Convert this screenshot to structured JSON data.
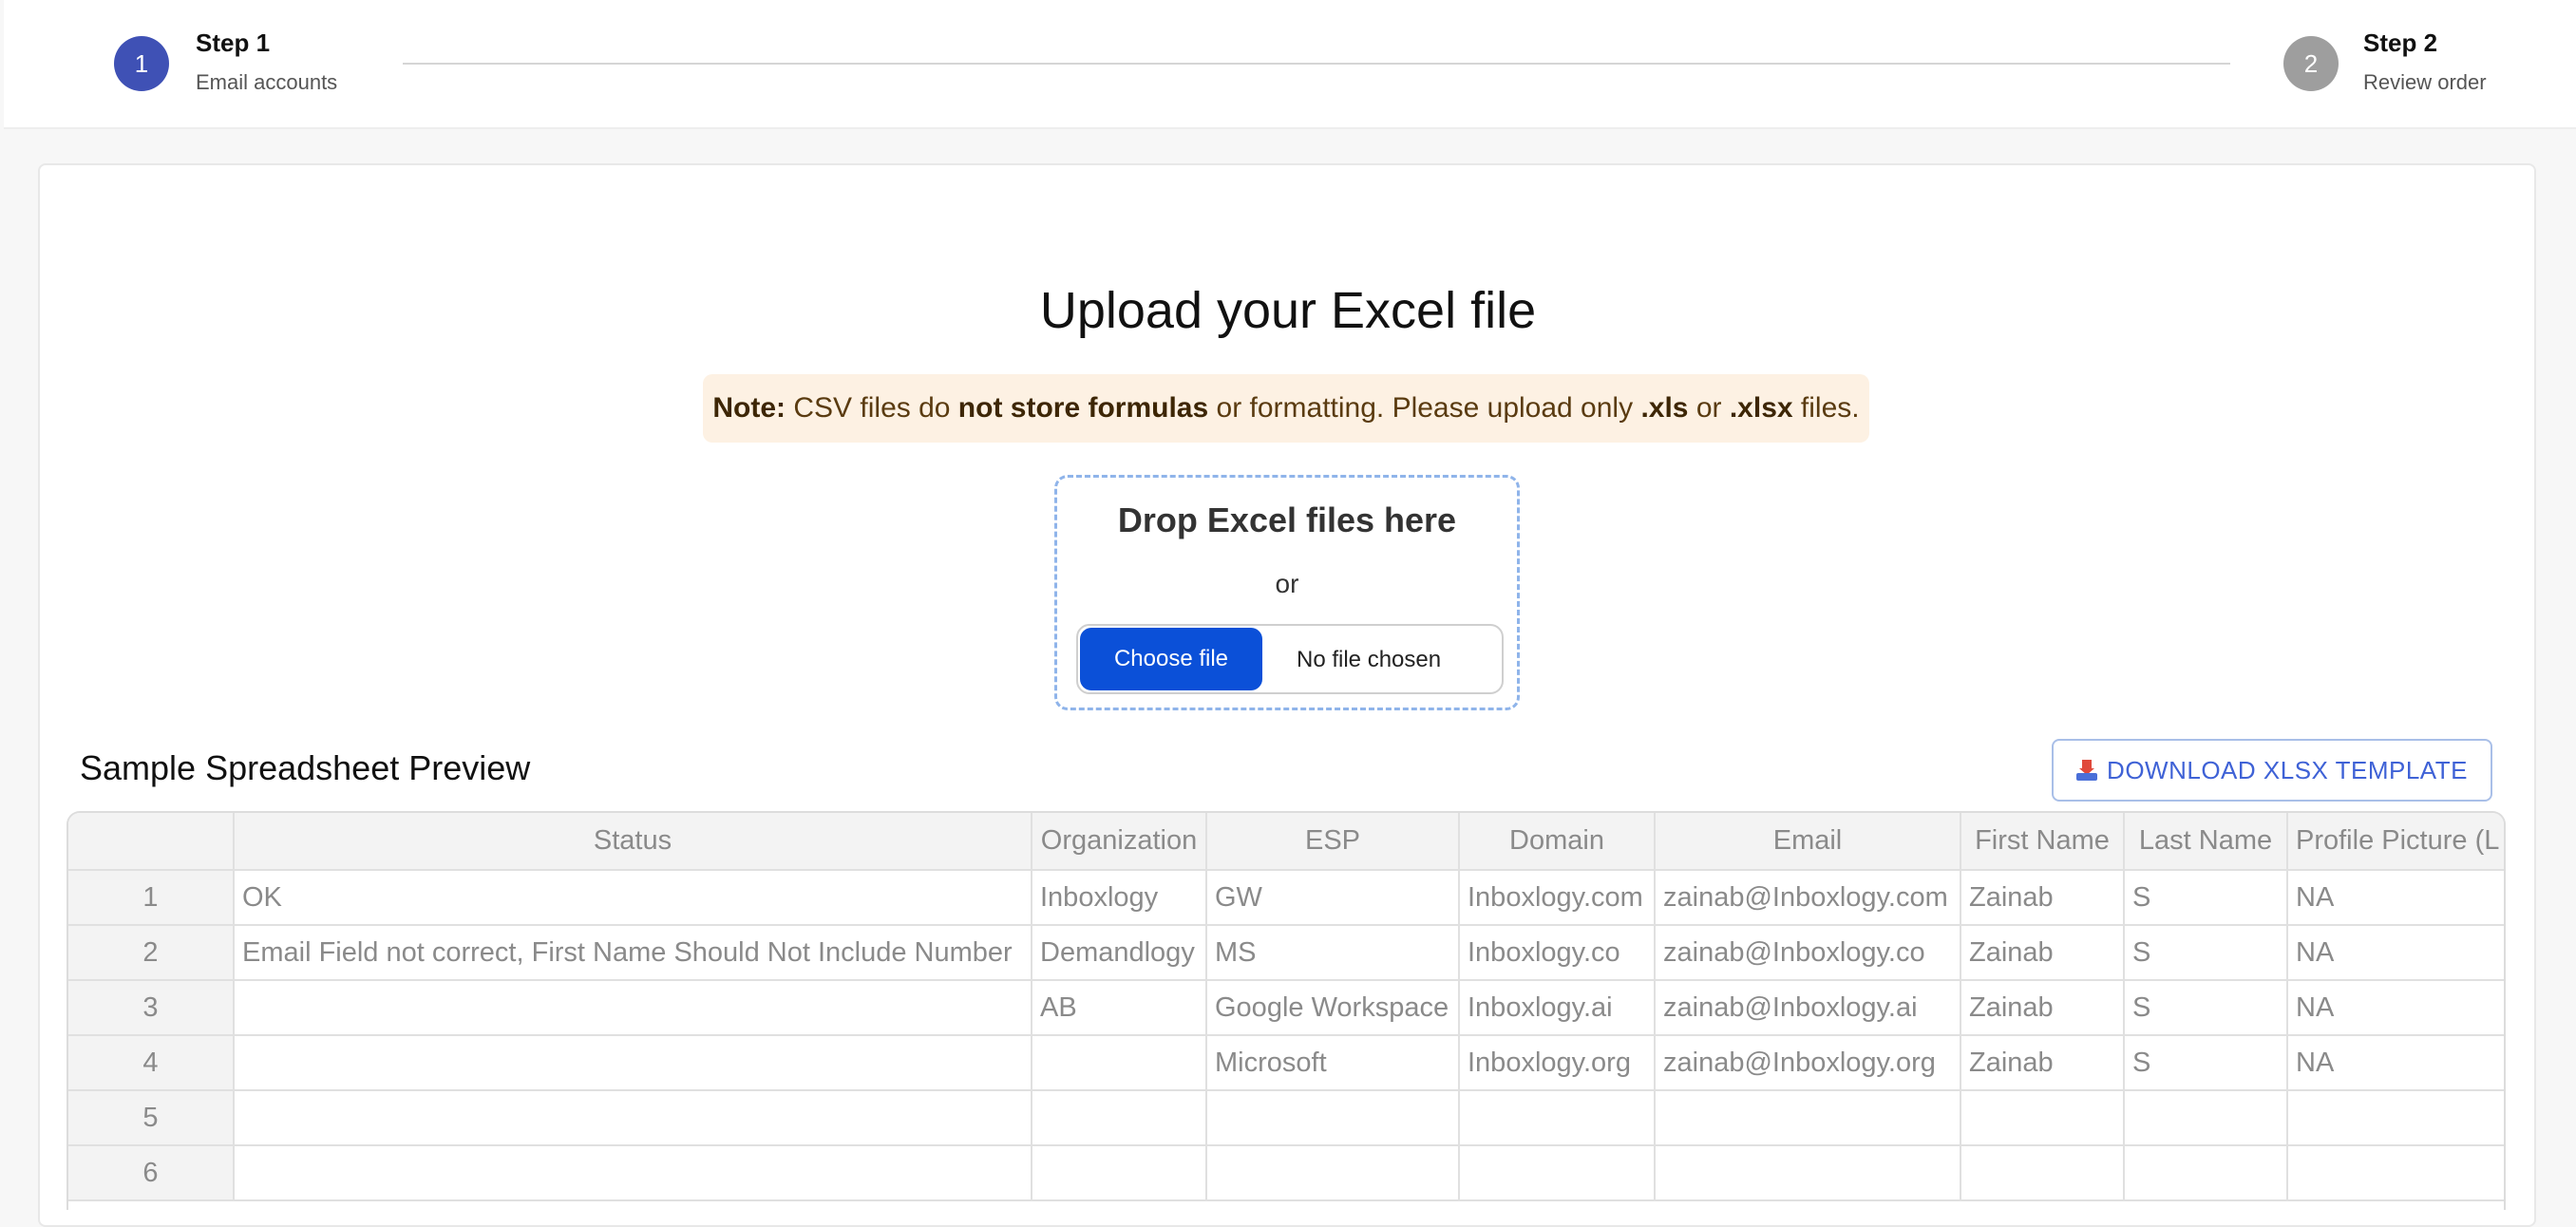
{
  "stepper": {
    "steps": [
      {
        "number": "1",
        "title": "Step 1",
        "subtitle": "Email accounts"
      },
      {
        "number": "2",
        "title": "Step 2",
        "subtitle": "Review order"
      }
    ]
  },
  "upload": {
    "title": "Upload your Excel file",
    "note": {
      "label": "Note:",
      "part1": " CSV files do ",
      "bold1": "not store formulas",
      "part2": " or formatting. Please upload only ",
      "bold2": ".xls",
      "part3": " or ",
      "bold3": ".xlsx",
      "part4": " files."
    },
    "drop_title": "Drop Excel files here",
    "or": "or",
    "choose_label": "Choose file",
    "no_file": "No file chosen"
  },
  "preview": {
    "title": "Sample Spreadsheet Preview",
    "download_label": "DOWNLOAD XLSX TEMPLATE",
    "download_icon": "inbox-tray-icon",
    "columns": [
      "",
      "Status",
      "Organization",
      "ESP",
      "Domain",
      "Email",
      "First Name",
      "Last Name",
      "Profile Picture (L"
    ],
    "rows": [
      [
        "1",
        "OK",
        "Inboxlogy",
        "GW",
        "Inboxlogy.com",
        "zainab@Inboxlogy.com",
        "Zainab",
        "S",
        "NA"
      ],
      [
        "2",
        "Email Field not correct, First Name Should Not Include Number",
        "Demandlogy",
        "MS",
        "Inboxlogy.co",
        "zainab@Inboxlogy.co",
        "Zainab",
        "S",
        "NA"
      ],
      [
        "3",
        "",
        "AB",
        "Google Workspace",
        "Inboxlogy.ai",
        "zainab@Inboxlogy.ai",
        "Zainab",
        "S",
        "NA"
      ],
      [
        "4",
        "",
        "",
        "Microsoft",
        "Inboxlogy.org",
        "zainab@Inboxlogy.org",
        "Zainab",
        "S",
        "NA"
      ],
      [
        "5",
        "",
        "",
        "",
        "",
        "",
        "",
        "",
        ""
      ],
      [
        "6",
        "",
        "",
        "",
        "",
        "",
        "",
        "",
        ""
      ]
    ]
  },
  "colors": {
    "step_active": "#3f51b5",
    "step_inactive": "#9e9e9e",
    "primary_button": "#0b50d8",
    "note_background": "#fdf1e3",
    "link_blue": "#3f62d6"
  }
}
